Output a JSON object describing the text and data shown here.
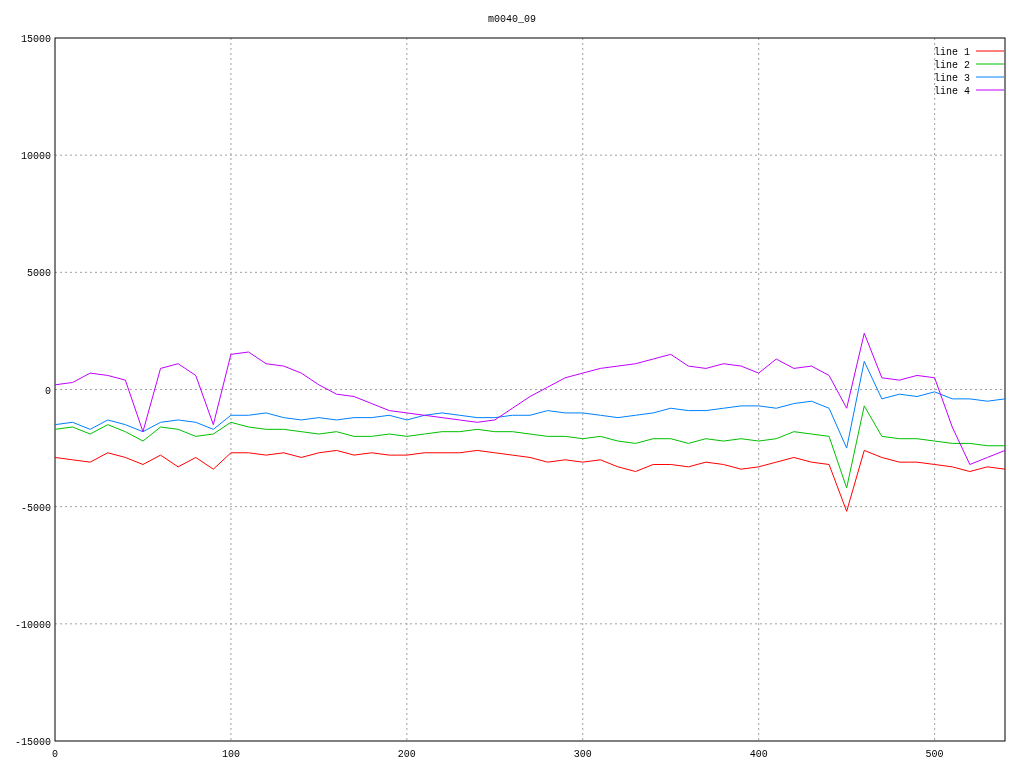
{
  "chart_data": {
    "type": "line",
    "title": "m0040_09",
    "x": [
      0,
      10,
      20,
      30,
      40,
      50,
      60,
      70,
      80,
      90,
      100,
      110,
      120,
      130,
      140,
      150,
      160,
      170,
      180,
      190,
      200,
      210,
      220,
      230,
      240,
      250,
      260,
      270,
      280,
      290,
      300,
      310,
      320,
      330,
      340,
      350,
      360,
      370,
      380,
      390,
      400,
      410,
      420,
      430,
      440,
      450,
      460,
      470,
      480,
      490,
      500,
      510,
      520,
      530,
      540
    ],
    "series": [
      {
        "name": "line 1",
        "color": "#ff0000",
        "values": [
          -2900,
          -3000,
          -3100,
          -2700,
          -2900,
          -3200,
          -2800,
          -3300,
          -2900,
          -3400,
          -2700,
          -2700,
          -2800,
          -2700,
          -2900,
          -2700,
          -2600,
          -2800,
          -2700,
          -2800,
          -2800,
          -2700,
          -2700,
          -2700,
          -2600,
          -2700,
          -2800,
          -2900,
          -3100,
          -3000,
          -3100,
          -3000,
          -3300,
          -3500,
          -3200,
          -3200,
          -3300,
          -3100,
          -3200,
          -3400,
          -3300,
          -3100,
          -2900,
          -3100,
          -3200,
          -5200,
          -2600,
          -2900,
          -3100,
          -3100,
          -3200,
          -3300,
          -3500,
          -3300,
          -3400
        ]
      },
      {
        "name": "line 2",
        "color": "#00c000",
        "values": [
          -1700,
          -1600,
          -1900,
          -1500,
          -1800,
          -2200,
          -1600,
          -1700,
          -2000,
          -1900,
          -1400,
          -1600,
          -1700,
          -1700,
          -1800,
          -1900,
          -1800,
          -2000,
          -2000,
          -1900,
          -2000,
          -1900,
          -1800,
          -1800,
          -1700,
          -1800,
          -1800,
          -1900,
          -2000,
          -2000,
          -2100,
          -2000,
          -2200,
          -2300,
          -2100,
          -2100,
          -2300,
          -2100,
          -2200,
          -2100,
          -2200,
          -2100,
          -1800,
          -1900,
          -2000,
          -4200,
          -700,
          -2000,
          -2100,
          -2100,
          -2200,
          -2300,
          -2300,
          -2400,
          -2400
        ]
      },
      {
        "name": "line 3",
        "color": "#0080ff",
        "values": [
          -1500,
          -1400,
          -1700,
          -1300,
          -1500,
          -1800,
          -1400,
          -1300,
          -1400,
          -1700,
          -1100,
          -1100,
          -1000,
          -1200,
          -1300,
          -1200,
          -1300,
          -1200,
          -1200,
          -1100,
          -1300,
          -1100,
          -1000,
          -1100,
          -1200,
          -1200,
          -1100,
          -1100,
          -900,
          -1000,
          -1000,
          -1100,
          -1200,
          -1100,
          -1000,
          -800,
          -900,
          -900,
          -800,
          -700,
          -700,
          -800,
          -600,
          -500,
          -800,
          -2500,
          1200,
          -400,
          -200,
          -300,
          -100,
          -400,
          -400,
          -500,
          -400
        ]
      },
      {
        "name": "line 4",
        "color": "#c000ff",
        "values": [
          200,
          300,
          700,
          600,
          400,
          -1800,
          900,
          1100,
          600,
          -1500,
          1500,
          1600,
          1100,
          1000,
          700,
          200,
          -200,
          -300,
          -600,
          -900,
          -1000,
          -1100,
          -1200,
          -1300,
          -1400,
          -1300,
          -800,
          -300,
          100,
          500,
          700,
          900,
          1000,
          1100,
          1300,
          1500,
          1000,
          900,
          1100,
          1000,
          700,
          1300,
          900,
          1000,
          600,
          -800,
          2400,
          500,
          400,
          600,
          500,
          -1600,
          -3200,
          -2900,
          -2600
        ]
      }
    ],
    "xlim": [
      0,
      540
    ],
    "ylim": [
      -15000,
      15000
    ],
    "xticks": [
      0,
      100,
      200,
      300,
      400,
      500
    ],
    "yticks": [
      -15000,
      -10000,
      -5000,
      0,
      5000,
      10000,
      15000
    ],
    "grid": true,
    "legend": true
  }
}
